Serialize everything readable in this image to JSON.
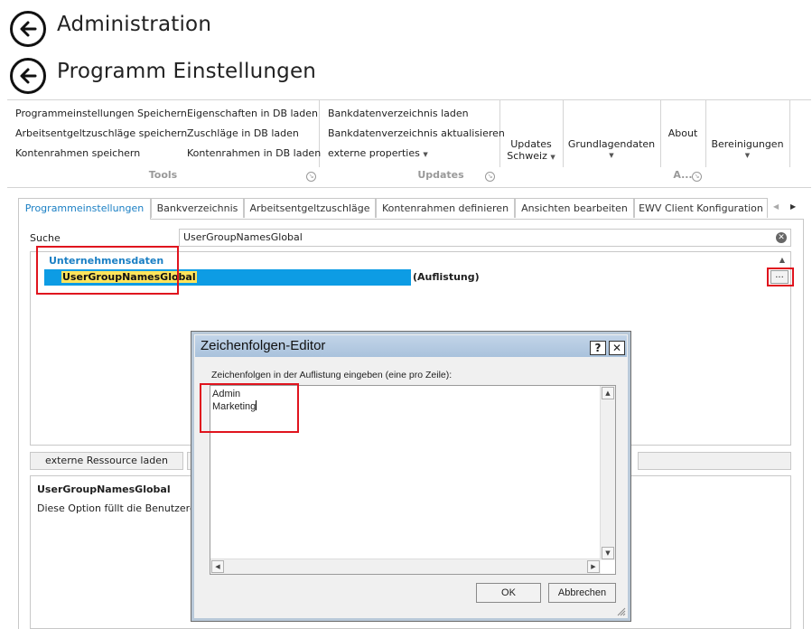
{
  "headings": {
    "admin": "Administration",
    "program_settings": "Programm Einstellungen"
  },
  "ribbon": {
    "tools": {
      "col1": [
        "Programmeinstellungen Speichern",
        "Arbeitsentgeltzuschläge speichern",
        "Kontenrahmen speichern"
      ],
      "col2": [
        "Eigenschaften in DB laden",
        "Zuschläge in DB laden",
        "Kontenrahmen in DB laden"
      ],
      "footer": "Tools"
    },
    "updates": {
      "items": [
        "Bankdatenverzeichnis laden",
        "Bankdatenverzeichnis aktualisieren",
        "externe properties"
      ],
      "big_line1": "Updates",
      "big_line2": "Schweiz",
      "footer": "Updates"
    },
    "grundlagendaten": "Grundlagendaten",
    "about": "About",
    "about_footer": "A...",
    "bereinigungen": "Bereinigungen"
  },
  "tabs": [
    {
      "label": "Programmeinstellungen"
    },
    {
      "label": "Bankverzeichnis"
    },
    {
      "label": "Arbeitsentgeltzuschläge"
    },
    {
      "label": "Kontenrahmen definieren"
    },
    {
      "label": "Ansichten bearbeiten"
    },
    {
      "label": "EWV Client Konfiguration"
    }
  ],
  "search": {
    "label": "Suche",
    "value": "UserGroupNamesGlobal"
  },
  "grid": {
    "category": "Unternehmensdaten",
    "property_name": "UserGroupNamesGlobal",
    "property_value": "(Auflistung)",
    "ellipsis": "..."
  },
  "buttons": {
    "external_resource": "externe Ressource laden"
  },
  "description": {
    "title": "UserGroupNamesGlobal",
    "text": "Diese Option füllt die Benutzergruppen"
  },
  "dialog": {
    "title": "Zeichenfolgen-Editor",
    "help": "?",
    "close": "✕",
    "instruction": "Zeichenfolgen in der Auflistung eingeben (eine pro Zeile):",
    "lines": [
      "Admin",
      "Marketing"
    ],
    "ok": "OK",
    "cancel": "Abbrechen"
  },
  "colors": {
    "accent_blue": "#1a7fc4",
    "selection_blue": "#0d9ce4",
    "highlight_yellow": "#ffe45c",
    "annotation_red": "#e0141e"
  }
}
